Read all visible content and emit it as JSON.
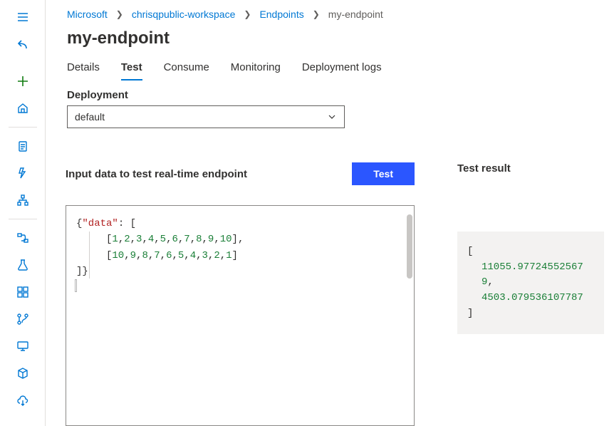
{
  "breadcrumb": {
    "items": [
      {
        "label": "Microsoft",
        "link": true
      },
      {
        "label": "chrisqpublic-workspace",
        "link": true
      },
      {
        "label": "Endpoints",
        "link": true
      },
      {
        "label": "my-endpoint",
        "link": false
      }
    ]
  },
  "page_title": "my-endpoint",
  "tabs": [
    {
      "label": "Details",
      "active": false
    },
    {
      "label": "Test",
      "active": true
    },
    {
      "label": "Consume",
      "active": false
    },
    {
      "label": "Monitoring",
      "active": false
    },
    {
      "label": "Deployment logs",
      "active": false
    }
  ],
  "deployment": {
    "label": "Deployment",
    "selected": "default"
  },
  "input_section": {
    "title": "Input data to test real-time endpoint",
    "test_button": "Test",
    "code": {
      "key": "\"data\"",
      "row1": {
        "nums": [
          1,
          2,
          3,
          4,
          5,
          6,
          7,
          8,
          9,
          10
        ]
      },
      "row2": {
        "nums": [
          10,
          9,
          8,
          7,
          6,
          5,
          4,
          3,
          2,
          1
        ]
      }
    }
  },
  "result_section": {
    "title": "Test result",
    "values": [
      "11055.977245525679",
      "4503.079536107787"
    ]
  },
  "sidebar": {
    "items": [
      {
        "name": "nav-menu-icon"
      },
      {
        "name": "back-icon"
      },
      {
        "sep": true
      },
      {
        "name": "add-icon",
        "green": true
      },
      {
        "name": "home-icon"
      },
      {
        "sep": true
      },
      {
        "name": "clipboard-icon"
      },
      {
        "name": "activity-icon"
      },
      {
        "name": "hierarchy-icon"
      },
      {
        "sep": true
      },
      {
        "name": "workflow-icon"
      },
      {
        "name": "beaker-icon"
      },
      {
        "name": "dashboard-icon"
      },
      {
        "name": "branch-icon"
      },
      {
        "name": "monitor-icon"
      },
      {
        "name": "cube-icon"
      },
      {
        "name": "cloud-icon"
      }
    ]
  }
}
